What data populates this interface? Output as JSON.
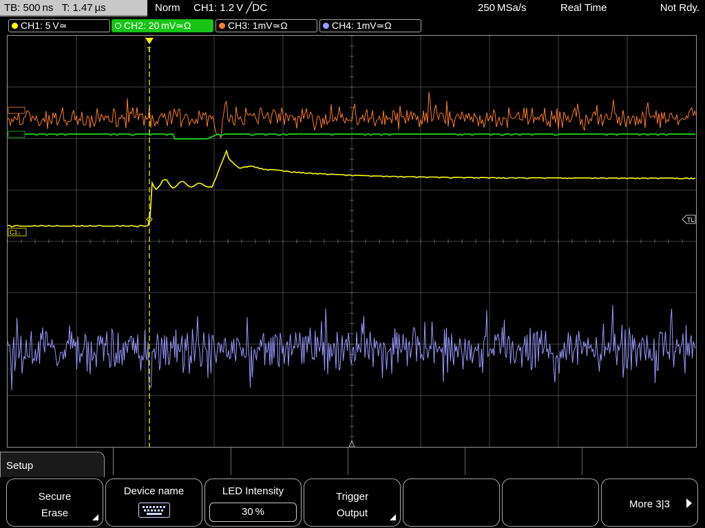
{
  "topbar": {
    "timebase": "TB: 500 ns",
    "trigger_time": "T: 1.47 µs",
    "mode": "Norm",
    "trigger_info": "CH1: 1.2 V ╱DC",
    "sample_rate": "250 MSa/s",
    "acq_mode": "Real Time",
    "status": "Not Rdy."
  },
  "channels": [
    {
      "label": "CH1: 5 V≃",
      "color": "#ffff00",
      "active": false
    },
    {
      "label": "CH2: 20 mV≃Ω",
      "color": "#19c419",
      "active": true
    },
    {
      "label": "CH3: 1mV≃Ω",
      "color": "#ff7f27",
      "active": false
    },
    {
      "label": "CH4: 1mV≃Ω",
      "color": "#9999ff",
      "active": false
    }
  ],
  "screen": {
    "markers": {
      "ch1": "C1↓",
      "trigger_level": "TL",
      "trigger_pos": "T"
    },
    "colors": {
      "ch1": "#ffff00",
      "ch2": "#19c419",
      "ch3": "#ff7f27",
      "ch4": "#9999ff",
      "grid": "#555555",
      "trigger_line": "#ffff00"
    }
  },
  "menu": {
    "title": "Setup",
    "softkeys": [
      {
        "line1": "Secure",
        "line2": "Erase",
        "has_submenu": true
      },
      {
        "line1": "Device name",
        "icon": "keyboard-icon"
      },
      {
        "line1": "LED Intensity",
        "value": "30 %"
      },
      {
        "line1": "Trigger",
        "line2": "Output",
        "has_submenu": true
      },
      {
        "line1": ""
      },
      {
        "line1": ""
      },
      {
        "line1": "More 3|3",
        "icon": "right-arrow-icon"
      }
    ]
  }
}
